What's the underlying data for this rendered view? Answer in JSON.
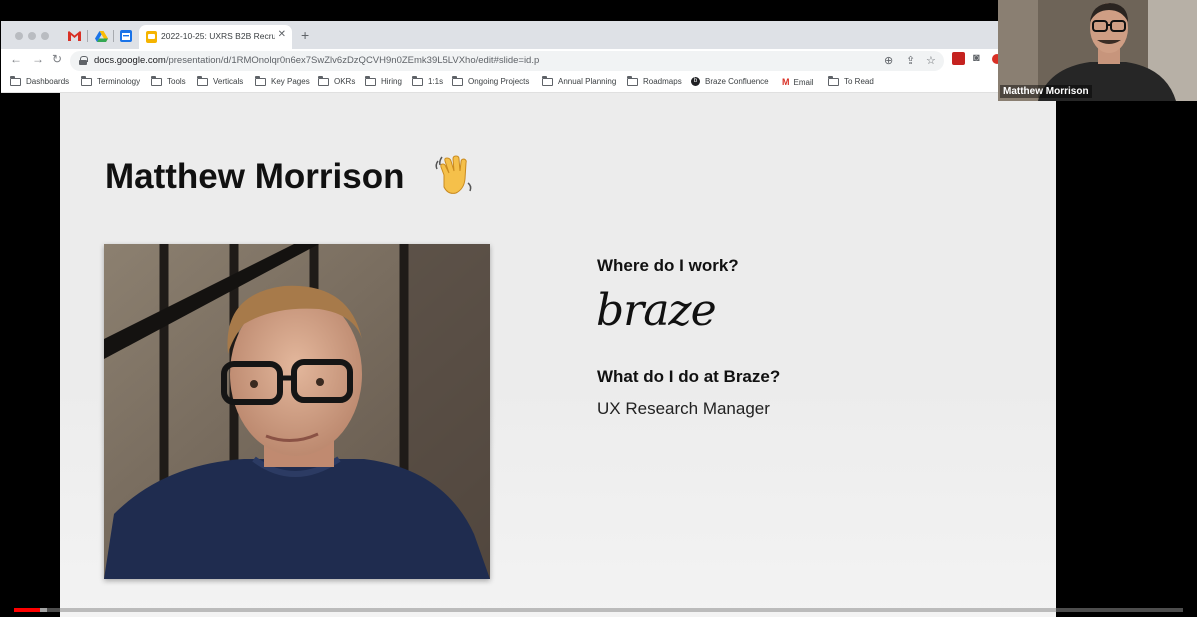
{
  "browser": {
    "active_tab": {
      "title": "2022-10-25: UXRS B2B Recrui"
    },
    "url": {
      "domain": "docs.google.com",
      "path": "/presentation/d/1RMOnolqr0n6ex7SwZlv6zDzQCVH9n0ZEmk39L5LVXho/edit#slide=id.p"
    },
    "bookmarks": [
      {
        "label": "Dashboards",
        "icon": "folder-icon"
      },
      {
        "label": "Terminology",
        "icon": "folder-icon"
      },
      {
        "label": "Tools",
        "icon": "folder-icon"
      },
      {
        "label": "Verticals",
        "icon": "folder-icon"
      },
      {
        "label": "Key Pages",
        "icon": "folder-icon"
      },
      {
        "label": "OKRs",
        "icon": "folder-icon"
      },
      {
        "label": "Hiring",
        "icon": "folder-icon"
      },
      {
        "label": "1:1s",
        "icon": "folder-icon"
      },
      {
        "label": "Ongoing Projects",
        "icon": "folder-icon"
      },
      {
        "label": "Annual Planning",
        "icon": "folder-icon"
      },
      {
        "label": "Roadmaps",
        "icon": "folder-icon"
      },
      {
        "label": "Braze Confluence",
        "icon": "braze-icon"
      },
      {
        "label": "Email",
        "icon": "gmail-icon"
      },
      {
        "label": "To Read",
        "icon": "folder-icon"
      }
    ]
  },
  "slide": {
    "title": "Matthew Morrison",
    "q1": "Where do I work?",
    "logo": "braze",
    "q2": "What do I do at Braze?",
    "a2": "UX Research Manager"
  },
  "participant": {
    "name": "Matthew Morrison"
  },
  "player": {
    "played_fraction": 0.022,
    "buffered_fraction": 0.028
  },
  "colors": {
    "progress": "#ff0000",
    "chrome": "#dee1e6",
    "slide_bg": "#ececec"
  }
}
